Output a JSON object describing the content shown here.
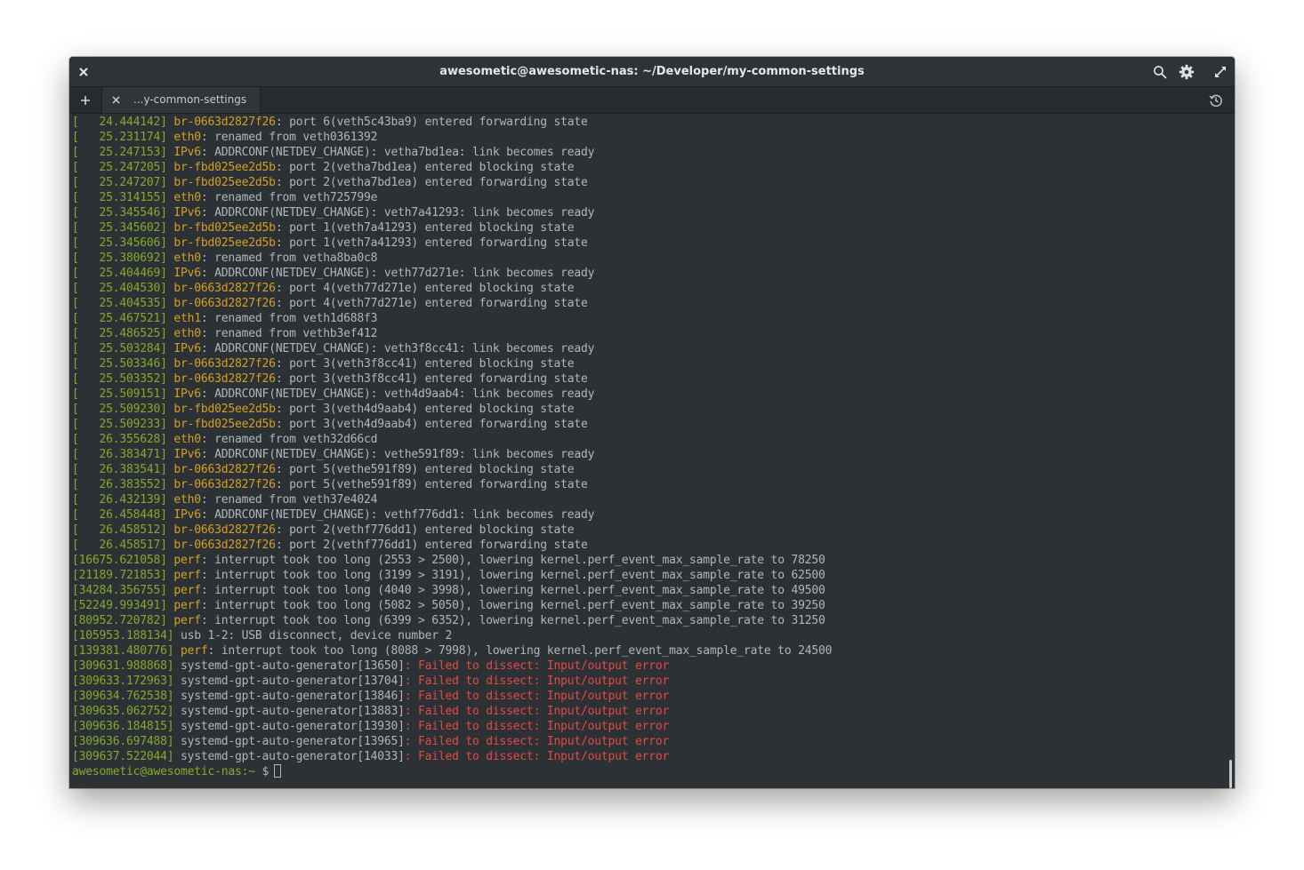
{
  "window": {
    "title": "awesometic@awesometic-nas: ~/Developer/my-common-settings"
  },
  "tabs": [
    {
      "label": "...y-common-settings"
    }
  ],
  "icons": {
    "close": "close-icon",
    "search": "search-icon",
    "settings": "gear-icon",
    "maximize": "maximize-icon",
    "new_tab": "plus-icon",
    "tab_close": "close-icon",
    "history": "history-icon"
  },
  "colors": {
    "timestamp": "#86a92c",
    "source": "#d5a021",
    "text": "#b2b6b8",
    "error": "#e44a44",
    "background": "#2b3135"
  },
  "terminal": {
    "lines": [
      {
        "ts": "[   24.444142] ",
        "src": "br-0663d2827f26",
        "msg": ": port 6(veth5c43ba9) entered forwarding state",
        "err": ""
      },
      {
        "ts": "[   25.231174] ",
        "src": "eth0",
        "msg": ": renamed from veth0361392",
        "err": ""
      },
      {
        "ts": "[   25.247153] ",
        "src": "IPv6",
        "msg": ": ADDRCONF(NETDEV_CHANGE): vetha7bd1ea: link becomes ready",
        "err": ""
      },
      {
        "ts": "[   25.247205] ",
        "src": "br-fbd025ee2d5b",
        "msg": ": port 2(vetha7bd1ea) entered blocking state",
        "err": ""
      },
      {
        "ts": "[   25.247207] ",
        "src": "br-fbd025ee2d5b",
        "msg": ": port 2(vetha7bd1ea) entered forwarding state",
        "err": ""
      },
      {
        "ts": "[   25.314155] ",
        "src": "eth0",
        "msg": ": renamed from veth725799e",
        "err": ""
      },
      {
        "ts": "[   25.345546] ",
        "src": "IPv6",
        "msg": ": ADDRCONF(NETDEV_CHANGE): veth7a41293: link becomes ready",
        "err": ""
      },
      {
        "ts": "[   25.345602] ",
        "src": "br-fbd025ee2d5b",
        "msg": ": port 1(veth7a41293) entered blocking state",
        "err": ""
      },
      {
        "ts": "[   25.345606] ",
        "src": "br-fbd025ee2d5b",
        "msg": ": port 1(veth7a41293) entered forwarding state",
        "err": ""
      },
      {
        "ts": "[   25.380692] ",
        "src": "eth0",
        "msg": ": renamed from vetha8ba0c8",
        "err": ""
      },
      {
        "ts": "[   25.404469] ",
        "src": "IPv6",
        "msg": ": ADDRCONF(NETDEV_CHANGE): veth77d271e: link becomes ready",
        "err": ""
      },
      {
        "ts": "[   25.404530] ",
        "src": "br-0663d2827f26",
        "msg": ": port 4(veth77d271e) entered blocking state",
        "err": ""
      },
      {
        "ts": "[   25.404535] ",
        "src": "br-0663d2827f26",
        "msg": ": port 4(veth77d271e) entered forwarding state",
        "err": ""
      },
      {
        "ts": "[   25.467521] ",
        "src": "eth1",
        "msg": ": renamed from veth1d688f3",
        "err": ""
      },
      {
        "ts": "[   25.486525] ",
        "src": "eth0",
        "msg": ": renamed from vethb3ef412",
        "err": ""
      },
      {
        "ts": "[   25.503284] ",
        "src": "IPv6",
        "msg": ": ADDRCONF(NETDEV_CHANGE): veth3f8cc41: link becomes ready",
        "err": ""
      },
      {
        "ts": "[   25.503346] ",
        "src": "br-0663d2827f26",
        "msg": ": port 3(veth3f8cc41) entered blocking state",
        "err": ""
      },
      {
        "ts": "[   25.503352] ",
        "src": "br-0663d2827f26",
        "msg": ": port 3(veth3f8cc41) entered forwarding state",
        "err": ""
      },
      {
        "ts": "[   25.509151] ",
        "src": "IPv6",
        "msg": ": ADDRCONF(NETDEV_CHANGE): veth4d9aab4: link becomes ready",
        "err": ""
      },
      {
        "ts": "[   25.509230] ",
        "src": "br-fbd025ee2d5b",
        "msg": ": port 3(veth4d9aab4) entered blocking state",
        "err": ""
      },
      {
        "ts": "[   25.509233] ",
        "src": "br-fbd025ee2d5b",
        "msg": ": port 3(veth4d9aab4) entered forwarding state",
        "err": ""
      },
      {
        "ts": "[   26.355628] ",
        "src": "eth0",
        "msg": ": renamed from veth32d66cd",
        "err": ""
      },
      {
        "ts": "[   26.383471] ",
        "src": "IPv6",
        "msg": ": ADDRCONF(NETDEV_CHANGE): vethe591f89: link becomes ready",
        "err": ""
      },
      {
        "ts": "[   26.383541] ",
        "src": "br-0663d2827f26",
        "msg": ": port 5(vethe591f89) entered blocking state",
        "err": ""
      },
      {
        "ts": "[   26.383552] ",
        "src": "br-0663d2827f26",
        "msg": ": port 5(vethe591f89) entered forwarding state",
        "err": ""
      },
      {
        "ts": "[   26.432139] ",
        "src": "eth0",
        "msg": ": renamed from veth37e4024",
        "err": ""
      },
      {
        "ts": "[   26.458448] ",
        "src": "IPv6",
        "msg": ": ADDRCONF(NETDEV_CHANGE): vethf776dd1: link becomes ready",
        "err": ""
      },
      {
        "ts": "[   26.458512] ",
        "src": "br-0663d2827f26",
        "msg": ": port 2(vethf776dd1) entered blocking state",
        "err": ""
      },
      {
        "ts": "[   26.458517] ",
        "src": "br-0663d2827f26",
        "msg": ": port 2(vethf776dd1) entered forwarding state",
        "err": ""
      },
      {
        "ts": "[16675.621058] ",
        "src": "perf",
        "msg": ": interrupt took too long (2553 > 2500), lowering kernel.perf_event_max_sample_rate to 78250",
        "err": ""
      },
      {
        "ts": "[21189.721853] ",
        "src": "perf",
        "msg": ": interrupt took too long (3199 > 3191), lowering kernel.perf_event_max_sample_rate to 62500",
        "err": ""
      },
      {
        "ts": "[34284.356755] ",
        "src": "perf",
        "msg": ": interrupt took too long (4040 > 3998), lowering kernel.perf_event_max_sample_rate to 49500",
        "err": ""
      },
      {
        "ts": "[52249.993491] ",
        "src": "perf",
        "msg": ": interrupt took too long (5082 > 5050), lowering kernel.perf_event_max_sample_rate to 39250",
        "err": ""
      },
      {
        "ts": "[80952.720782] ",
        "src": "perf",
        "msg": ": interrupt took too long (6399 > 6352), lowering kernel.perf_event_max_sample_rate to 31250",
        "err": ""
      },
      {
        "ts": "[105953.188134] ",
        "src": "",
        "msg": "usb 1-2: USB disconnect, device number 2",
        "err": ""
      },
      {
        "ts": "[139381.480776] ",
        "src": "perf",
        "msg": ": interrupt took too long (8088 > 7998), lowering kernel.perf_event_max_sample_rate to 24500",
        "err": ""
      },
      {
        "ts": "[309631.988868] ",
        "src": "",
        "msg": "systemd-gpt-auto-generator[13650]",
        "err": ": Failed to dissect: Input/output error"
      },
      {
        "ts": "[309633.172963] ",
        "src": "",
        "msg": "systemd-gpt-auto-generator[13704]",
        "err": ": Failed to dissect: Input/output error"
      },
      {
        "ts": "[309634.762538] ",
        "src": "",
        "msg": "systemd-gpt-auto-generator[13846]",
        "err": ": Failed to dissect: Input/output error"
      },
      {
        "ts": "[309635.062752] ",
        "src": "",
        "msg": "systemd-gpt-auto-generator[13883]",
        "err": ": Failed to dissect: Input/output error"
      },
      {
        "ts": "[309636.184815] ",
        "src": "",
        "msg": "systemd-gpt-auto-generator[13930]",
        "err": ": Failed to dissect: Input/output error"
      },
      {
        "ts": "[309636.697488] ",
        "src": "",
        "msg": "systemd-gpt-auto-generator[13965]",
        "err": ": Failed to dissect: Input/output error"
      },
      {
        "ts": "[309637.522044] ",
        "src": "",
        "msg": "systemd-gpt-auto-generator[14033]",
        "err": ": Failed to dissect: Input/output error"
      }
    ],
    "prompt": {
      "user": "awesometic@awesometic-nas:~",
      "symbol": " $"
    }
  }
}
